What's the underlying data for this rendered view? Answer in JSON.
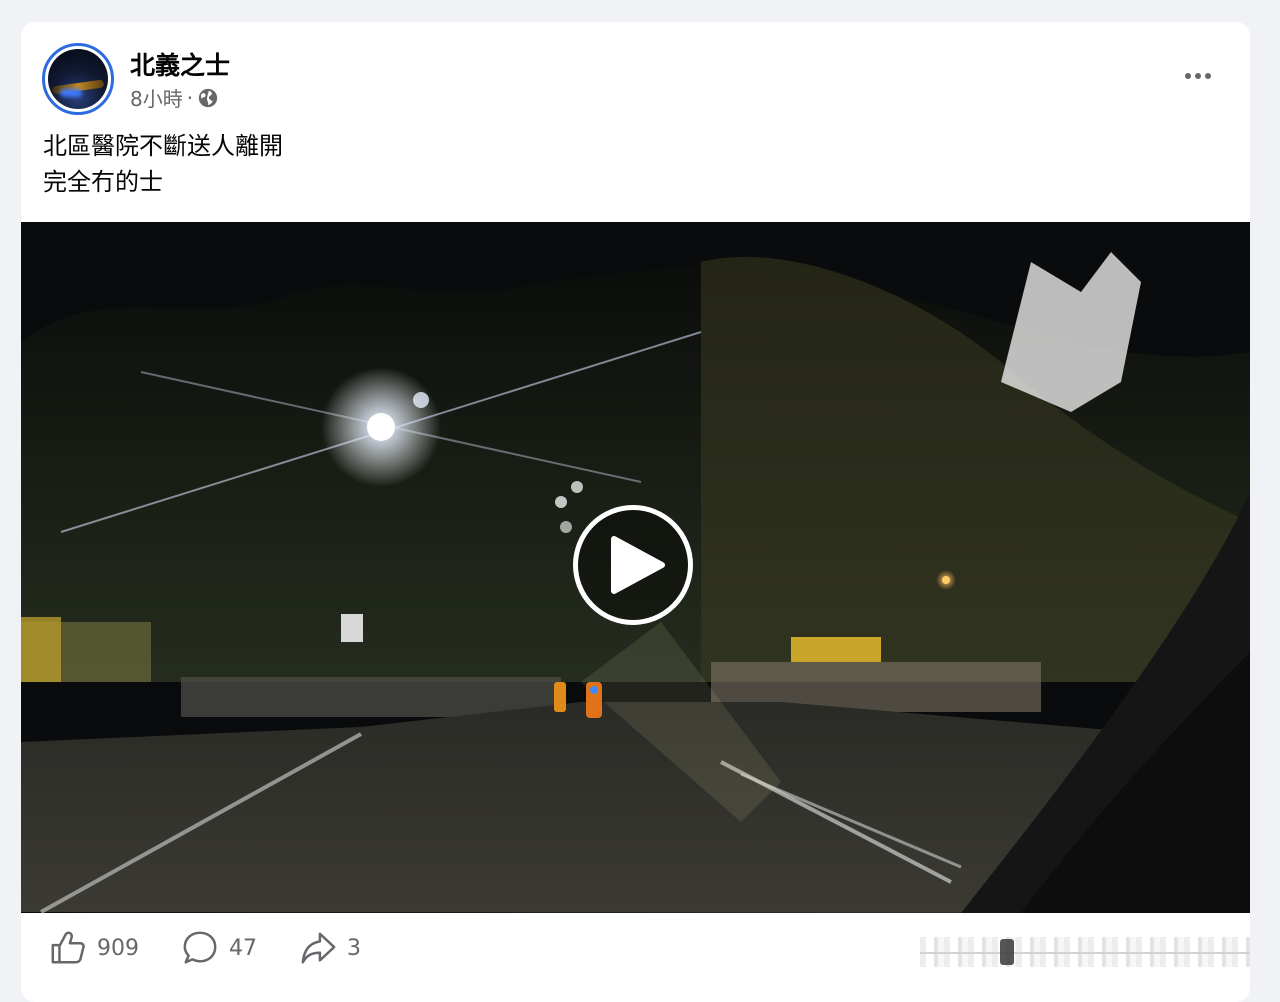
{
  "post": {
    "author": "北義之士",
    "time": "8小時",
    "separator": "·",
    "privacy_icon": "globe-icon",
    "text_lines": [
      "北區醫院不斷送人離開",
      "完全冇的士"
    ],
    "more_icon": "more-horizontal-icon"
  },
  "video": {
    "play_icon": "play-icon",
    "description_hidden": ""
  },
  "actions": {
    "like_count": "909",
    "comment_count": "47",
    "share_count": "3"
  },
  "colors": {
    "accent": "#2d6cdf",
    "text_primary": "#050505",
    "text_secondary": "#65676b",
    "background": "#f0f2f5",
    "card": "#ffffff"
  }
}
